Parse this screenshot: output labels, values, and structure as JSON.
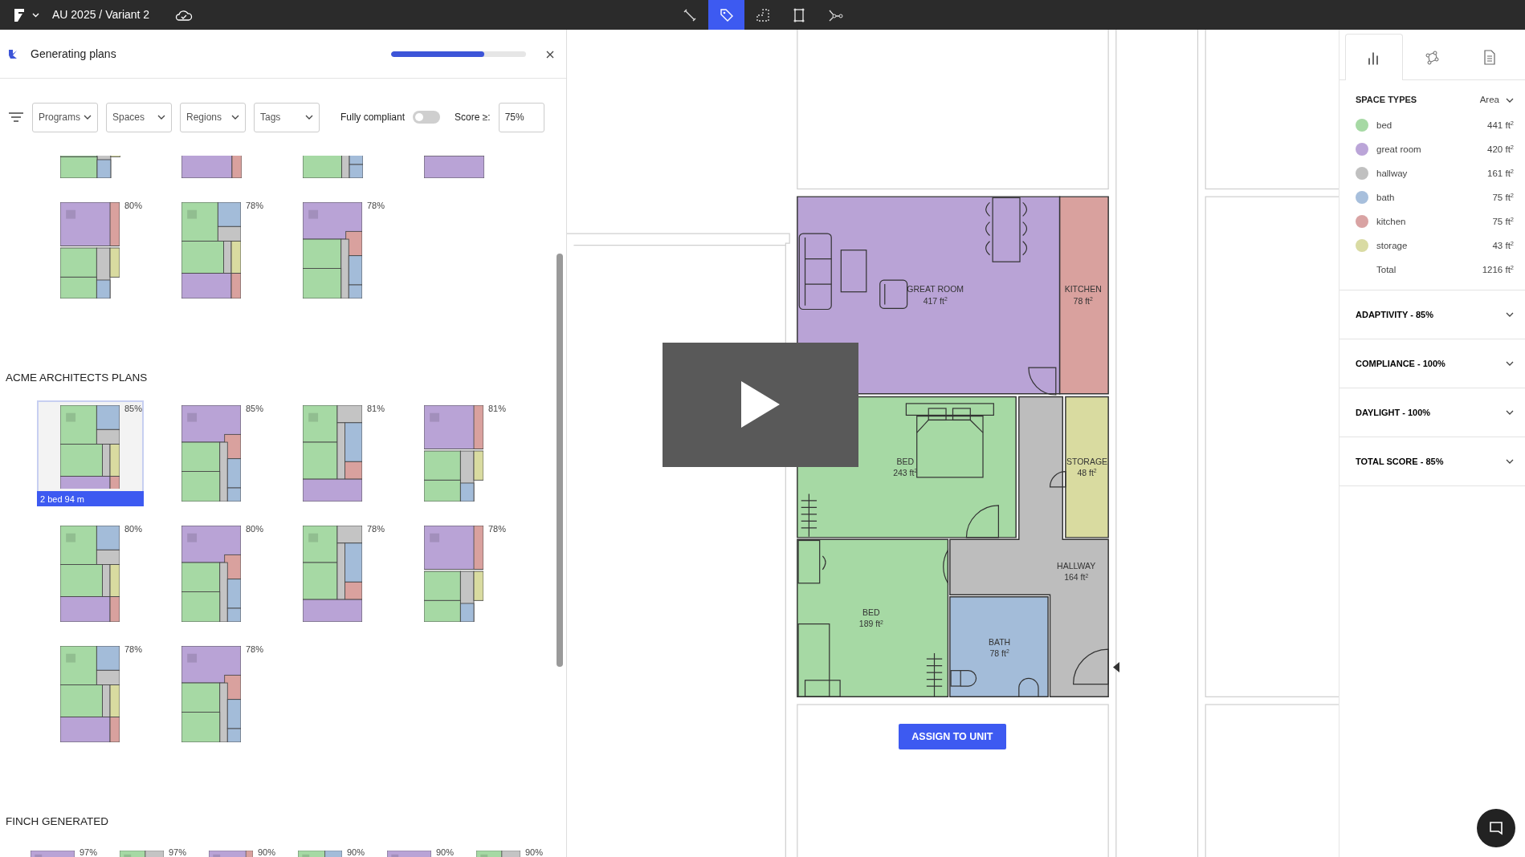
{
  "topbar": {
    "project": "AU 2025 / Variant 2",
    "tools": [
      {
        "kind": "measure",
        "selected": false
      },
      {
        "kind": "tag",
        "selected": true
      },
      {
        "kind": "area",
        "selected": false
      },
      {
        "kind": "frame",
        "selected": false
      },
      {
        "kind": "connect",
        "selected": false
      }
    ]
  },
  "generating": {
    "title": "Generating plans",
    "level": 0.69
  },
  "filters": {
    "dropdowns": [
      "Programs",
      "Spaces",
      "Regions",
      "Tags"
    ],
    "toggle": {
      "label": "Fully compliant",
      "on": false
    },
    "score": {
      "label": "Score ≥:",
      "value": "75%"
    }
  },
  "sections": [
    {
      "plans": [
        {
          "selected": false
        },
        {
          "selected": false
        },
        {
          "selected": false
        },
        {
          "selected": false
        },
        {
          "score": "80%",
          "selected": false
        },
        {
          "score": "78%",
          "selected": false
        },
        {
          "score": "78%",
          "selected": false
        }
      ]
    },
    {
      "title": "ACME ARCHITECTS PLANS",
      "plans": [
        {
          "score": "85%",
          "selected": true,
          "caption": "2 bed 94 m"
        },
        {
          "score": "85%",
          "selected": false
        },
        {
          "score": "81%",
          "selected": false
        },
        {
          "score": "81%",
          "selected": false
        },
        {
          "score": "80%",
          "selected": false
        },
        {
          "score": "80%",
          "selected": false
        },
        {
          "score": "78%",
          "selected": false
        },
        {
          "score": "78%",
          "selected": false
        },
        {
          "score": "78%",
          "selected": false
        },
        {
          "score": "78%",
          "selected": false
        }
      ]
    },
    {
      "title": "FINCH GENERATED",
      "compact": true,
      "plans": [
        {
          "score": "97%",
          "selected": false
        },
        {
          "score": "97%",
          "selected": false
        },
        {
          "score": "90%",
          "selected": false
        },
        {
          "score": "90%",
          "selected": false
        },
        {
          "score": "90%",
          "selected": false
        },
        {
          "score": "90%",
          "selected": false
        }
      ]
    }
  ],
  "canvas": {
    "rooms": [
      {
        "name": "GREAT ROOM",
        "area": "417 ft$^{2}$",
        "color": "#b9a3d6"
      },
      {
        "name": "KITCHEN",
        "area": "78 ft$^{2}$",
        "color": "#d9a19e"
      },
      {
        "name": "BED",
        "area": "243 ft$^{2}$",
        "color": "#a6d9a4"
      },
      {
        "name": "STORAGE",
        "area": "48 ft$^{2}$",
        "color": "#d9dba0"
      },
      {
        "name": "HALLWAY",
        "area": "164 ft$^{2}$",
        "color": "#bdbdbd"
      },
      {
        "name": "BED",
        "area": "189 ft$^{2}$",
        "color": "#a6d9a4"
      },
      {
        "name": "BATH",
        "area": "78 ft$^{2}$",
        "color": "#a3bcd9"
      }
    ],
    "button": "ASSIGN TO UNIT"
  },
  "right": {
    "tabs": [
      {
        "kind": "chart",
        "selected": true
      },
      {
        "kind": "graph",
        "selected": false
      },
      {
        "kind": "document",
        "selected": false
      }
    ],
    "space_types": {
      "title": "SPACE TYPES",
      "metric": "Area",
      "items": [
        {
          "name": "bed",
          "value": "441 ft$^{2}$",
          "color": "#a6d9a4"
        },
        {
          "name": "great room",
          "value": "420 ft$^{2}$",
          "color": "#bba5d8"
        },
        {
          "name": "hallway",
          "value": "161 ft$^{2}$",
          "color": "#c0c0c0"
        },
        {
          "name": "bath",
          "value": "75 ft$^{2}$",
          "color": "#a7bfdc"
        },
        {
          "name": "kitchen",
          "value": "75 ft$^{2}$",
          "color": "#d9a3a3"
        },
        {
          "name": "storage",
          "value": "43 ft$^{2}$",
          "color": "#d9dba3"
        }
      ],
      "total": {
        "label": "Total",
        "value": "1216 ft$^{2}$"
      }
    },
    "sections": [
      {
        "title": "ADAPTIVITY - 85%",
        "expanded": false
      },
      {
        "title": "COMPLIANCE - 100%",
        "expanded": false
      },
      {
        "title": "DAYLIGHT - 100%",
        "expanded": false
      },
      {
        "title": "TOTAL SCORE - 85%",
        "expanded": false
      }
    ]
  }
}
